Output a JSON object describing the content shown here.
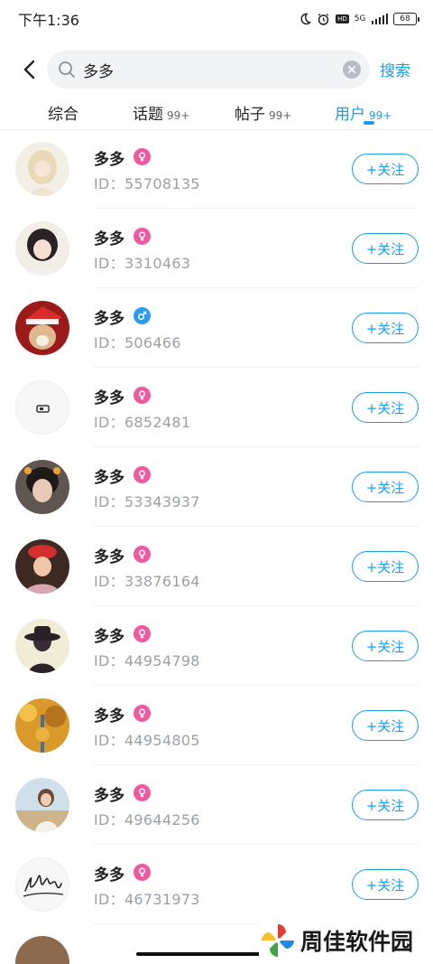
{
  "status_bar": {
    "time": "下午1:36",
    "network": "5G",
    "battery": "68"
  },
  "search": {
    "query": "多多",
    "button_label": "搜索"
  },
  "tabs": [
    {
      "label": "综合",
      "count": ""
    },
    {
      "label": "话题",
      "count": "99+"
    },
    {
      "label": "帖子",
      "count": "99+"
    },
    {
      "label": "用户",
      "count": "99+"
    }
  ],
  "active_tab": "用户",
  "colors": {
    "accent": "#1a9cf0",
    "female_badge": "#ee5aa0",
    "male_badge": "#2d9cea"
  },
  "users": [
    {
      "name": "多多",
      "gender": "female",
      "id_text": "ID：55708135",
      "follow_label": "+关注"
    },
    {
      "name": "多多",
      "gender": "female",
      "id_text": "ID：3310463",
      "follow_label": "+关注"
    },
    {
      "name": "多多",
      "gender": "male",
      "id_text": "ID：506466",
      "follow_label": "+关注"
    },
    {
      "name": "多多",
      "gender": "female",
      "id_text": "ID：6852481",
      "follow_label": "+关注"
    },
    {
      "name": "多多",
      "gender": "female",
      "id_text": "ID：53343937",
      "follow_label": "+关注"
    },
    {
      "name": "多多",
      "gender": "female",
      "id_text": "ID：33876164",
      "follow_label": "+关注"
    },
    {
      "name": "多多",
      "gender": "female",
      "id_text": "ID：44954798",
      "follow_label": "+关注"
    },
    {
      "name": "多多",
      "gender": "female",
      "id_text": "ID：44954805",
      "follow_label": "+关注"
    },
    {
      "name": "多多",
      "gender": "female",
      "id_text": "ID：49644256",
      "follow_label": "+关注"
    },
    {
      "name": "多多",
      "gender": "female",
      "id_text": "ID：46731973",
      "follow_label": "+关注"
    }
  ],
  "watermark": {
    "text": "周佳软件园"
  }
}
